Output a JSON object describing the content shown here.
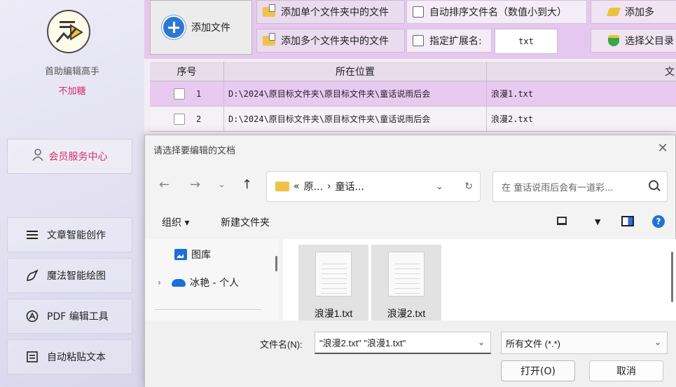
{
  "sidebar": {
    "app_name": "首助编辑高手",
    "slogan": "不加糖",
    "member_label": "会员服务中心",
    "items": [
      {
        "label": "文章智能创作",
        "icon": "list-icon"
      },
      {
        "label": "魔法智能绘图",
        "icon": "wand-icon"
      },
      {
        "label": "PDF 编辑工具",
        "icon": "pdf-icon"
      },
      {
        "label": "自动粘贴文本",
        "icon": "paste-icon"
      }
    ]
  },
  "toolbar": {
    "add_file": "添加文件",
    "add_single_folder": "添加单个文件夹中的文件",
    "add_multi_folder": "添加多个文件夹中的文件",
    "auto_sort": "自动排序文件名（数值小到大）",
    "specify_ext": "指定扩展名:",
    "ext_value": "txt",
    "add_right": "添加多",
    "choose_parent": "选择父目录"
  },
  "table": {
    "headers": [
      "序号",
      "所在位置",
      "文"
    ],
    "rows": [
      {
        "index": "1",
        "location": "D:\\2024\\原目标文件夹\\原目标文件夹\\童话说雨后会",
        "name": "浪漫1.txt"
      },
      {
        "index": "2",
        "location": "D:\\2024\\原目标文件夹\\原目标文件夹\\童话说雨后会",
        "name": "浪漫2.txt"
      }
    ]
  },
  "dialog": {
    "title": "请选择要编辑的文档",
    "address_prefix": "«",
    "address_part1": "原...",
    "address_sep": "›",
    "address_part2": "童话...",
    "search_placeholder": "在 童话说雨后会有一道彩...",
    "organize": "组织 ▾",
    "new_folder": "新建文件夹",
    "tree": [
      {
        "label": "图库"
      },
      {
        "label": "冰艳 - 个人"
      }
    ],
    "files": [
      "浪漫1.txt",
      "浪漫2.txt"
    ],
    "filename_label": "文件名(N):",
    "filename_value": "\"浪漫2.txt\" \"浪漫1.txt\"",
    "filter_value": "所有文件 (*.*)",
    "open_label": "打开(O)",
    "cancel_label": "取消"
  },
  "colors": {
    "accent": "#d4306a",
    "toolbar_bg": "#e6c7ef",
    "selected_row": "#e8c9f0",
    "primary_blue": "#2f77d6"
  }
}
